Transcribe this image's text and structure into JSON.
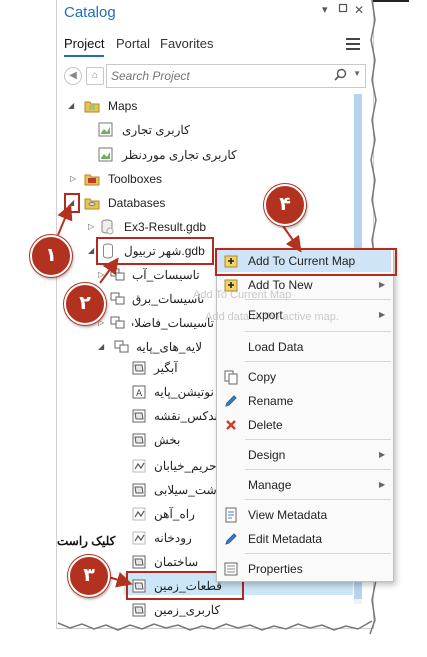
{
  "pane": {
    "title": "Catalog",
    "tabs": [
      "Project",
      "Portal",
      "Favorites"
    ],
    "search_placeholder": "Search Project"
  },
  "tree": {
    "maps": "Maps",
    "map_items": [
      "کاربری تجاری",
      "کاربری تجاری موردنظر"
    ],
    "toolboxes": "Toolboxes",
    "databases": "Databases",
    "gdb1": "Ex3-Result.gdb",
    "gdb2": "شهر تربیول.gdb",
    "datasets": [
      "تاسیسات_آب",
      "تاسیسات_برق",
      "تاسیسات_فاضلاب",
      "لایه_های_پایه"
    ],
    "layers": [
      "آبگیر",
      "نوتیشن_پایه",
      "ندکس_نقشه",
      "بخش",
      "حریم_خیابان",
      "شت_سیلابی",
      "راه_آهن",
      "رودخانه",
      "ساختمان",
      "قطعات_زمین",
      "کاربری_زمین"
    ]
  },
  "context_menu": {
    "items": [
      {
        "label": "Add To Current Map",
        "arrow": false,
        "icon": "add-layer-icon"
      },
      {
        "label": "Add To New",
        "arrow": true,
        "icon": "add-layer-icon"
      },
      {
        "label": "Export",
        "arrow": true,
        "icon": ""
      },
      {
        "label": "Load Data",
        "arrow": false,
        "icon": ""
      },
      {
        "label": "Copy",
        "arrow": false,
        "icon": "copy-icon"
      },
      {
        "label": "Rename",
        "arrow": false,
        "icon": "pencil-icon"
      },
      {
        "label": "Delete",
        "arrow": false,
        "icon": "delete-x-icon"
      },
      {
        "label": "Design",
        "arrow": true,
        "icon": ""
      },
      {
        "label": "Manage",
        "arrow": true,
        "icon": ""
      },
      {
        "label": "View Metadata",
        "arrow": false,
        "icon": "metadata-icon"
      },
      {
        "label": "Edit Metadata",
        "arrow": false,
        "icon": "pencil-icon"
      },
      {
        "label": "Properties",
        "arrow": false,
        "icon": "properties-icon"
      }
    ],
    "ghost_tooltip": [
      "Add To Current Map",
      "Add data to the active map."
    ]
  },
  "annotations": {
    "step1": "۱",
    "step2": "۲",
    "step3": "۳",
    "step4": "۴",
    "right_click_note": "کلیک راست"
  },
  "colors": {
    "accent": "#1e6fb8",
    "callout": "#b3311f",
    "highlight": "#cfe5f7"
  }
}
